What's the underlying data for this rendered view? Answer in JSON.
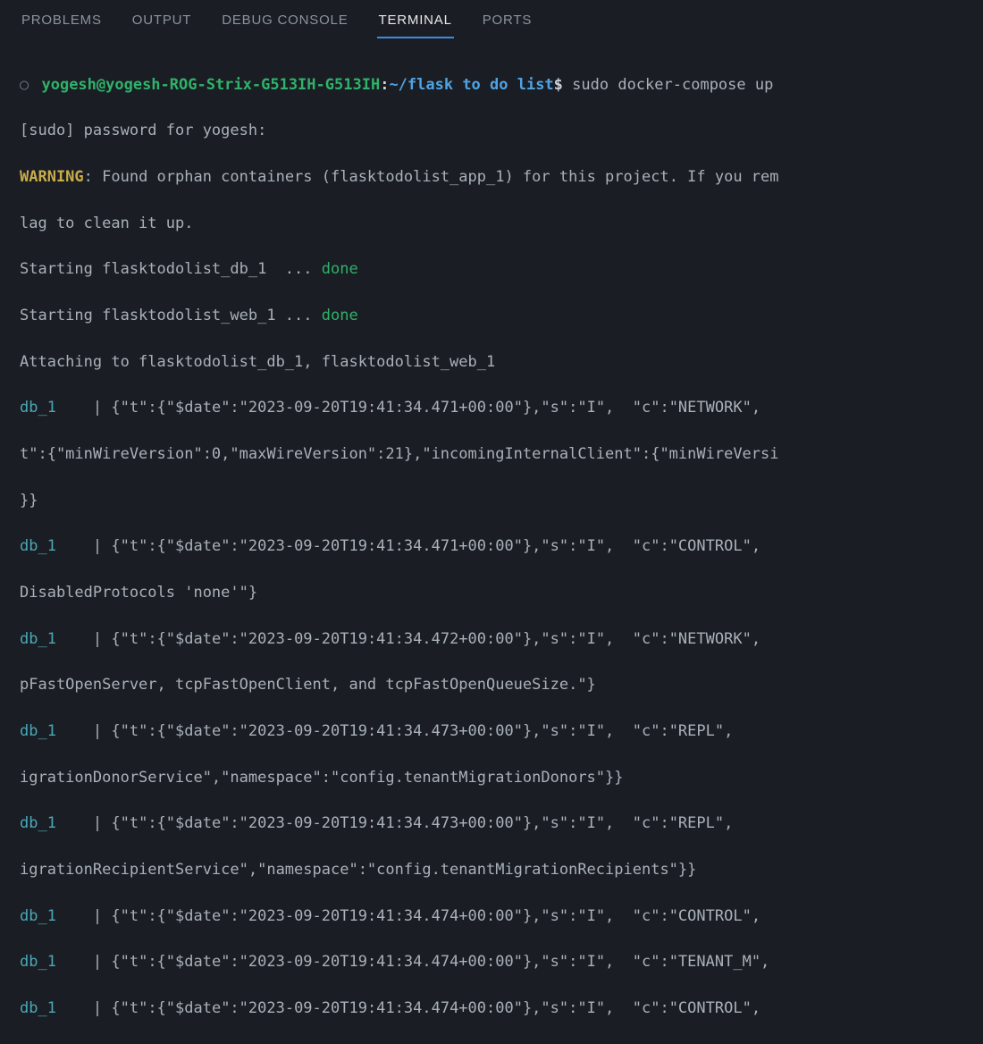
{
  "tabs": [
    {
      "label": "PROBLEMS",
      "active": false
    },
    {
      "label": "OUTPUT",
      "active": false
    },
    {
      "label": "DEBUG CONSOLE",
      "active": false
    },
    {
      "label": "TERMINAL",
      "active": true
    },
    {
      "label": "PORTS",
      "active": false
    }
  ],
  "prompt": {
    "user_host": "yogesh@yogesh-ROG-Strix-G513IH-G513IH",
    "colon": ":",
    "cwd": "~/flask to do list",
    "dollar": "$",
    "command": "sudo docker-compose up"
  },
  "lines": {
    "sudo_pw": "[sudo] password for yogesh:",
    "warning_label": "WARNING",
    "warning_rest": ": Found orphan containers (flasktodolist_app_1) for this project. If you rem",
    "warning_line2": "lag to clean it up.",
    "start_db_pre": "Starting flasktodolist_db_1  ... ",
    "start_web_pre": "Starting flasktodolist_web_1 ... ",
    "done": "done",
    "attaching": "Attaching to flasktodolist_db_1, flasktodolist_web_1",
    "db_label": "db_1   ",
    "pipe": " | ",
    "l1a": "{\"t\":{\"$date\":\"2023-09-20T19:41:34.471+00:00\"},\"s\":\"I\",  \"c\":\"NETWORK\",  ",
    "l1b": "t\":{\"minWireVersion\":0,\"maxWireVersion\":21},\"incomingInternalClient\":{\"minWireVersi",
    "l1c": "}}",
    "l2a": "{\"t\":{\"$date\":\"2023-09-20T19:41:34.471+00:00\"},\"s\":\"I\",  \"c\":\"CONTROL\",  ",
    "l2b": "DisabledProtocols 'none'\"}",
    "l3a": "{\"t\":{\"$date\":\"2023-09-20T19:41:34.472+00:00\"},\"s\":\"I\",  \"c\":\"NETWORK\",  ",
    "l3b": "pFastOpenServer, tcpFastOpenClient, and tcpFastOpenQueueSize.\"}",
    "l4a": "{\"t\":{\"$date\":\"2023-09-20T19:41:34.473+00:00\"},\"s\":\"I\",  \"c\":\"REPL\",     ",
    "l4b": "igrationDonorService\",\"namespace\":\"config.tenantMigrationDonors\"}}",
    "l5a": "{\"t\":{\"$date\":\"2023-09-20T19:41:34.473+00:00\"},\"s\":\"I\",  \"c\":\"REPL\",     ",
    "l5b": "igrationRecipientService\",\"namespace\":\"config.tenantMigrationRecipients\"}}",
    "l6": "{\"t\":{\"$date\":\"2023-09-20T19:41:34.474+00:00\"},\"s\":\"I\",  \"c\":\"CONTROL\",  ",
    "l7": "{\"t\":{\"$date\":\"2023-09-20T19:41:34.474+00:00\"},\"s\":\"I\",  \"c\":\"TENANT_M\", ",
    "l8": "{\"t\":{\"$date\":\"2023-09-20T19:41:34.474+00:00\"},\"s\":\"I\",  \"c\":\"CONTROL\",  "
  }
}
